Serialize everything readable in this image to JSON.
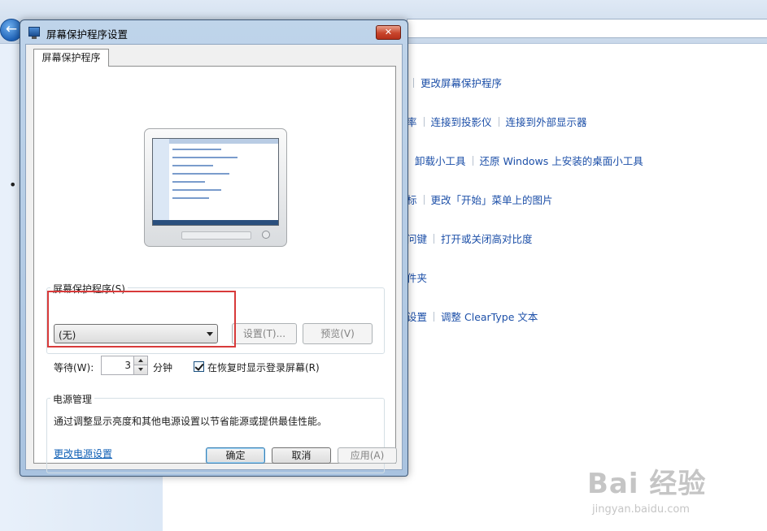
{
  "background": {
    "links": [
      {
        "items": [
          "更改屏幕保护程序"
        ]
      },
      {
        "items": [
          "率",
          "连接到投影仪",
          "连接到外部显示器"
        ]
      },
      {
        "items": [
          "卸载小工具",
          "还原 Windows 上安装的桌面小工具"
        ]
      },
      {
        "items": [
          "标",
          "更改「开始」菜单上的图片"
        ]
      },
      {
        "items": [
          "问键",
          "打开或关闭高对比度"
        ]
      },
      {
        "items": [
          "件夹"
        ]
      },
      {
        "items": [
          "设置",
          "调整 ClearType 文本"
        ]
      }
    ],
    "back_icon": "arrow-left-icon"
  },
  "dialog": {
    "title": "屏幕保护程序设置",
    "close_label": "✕",
    "tab_label": "屏幕保护程序",
    "screensaver": {
      "group_label": "屏幕保护程序(S)",
      "selected": "(无)",
      "settings_button": "设置(T)...",
      "preview_button": "预览(V)"
    },
    "wait": {
      "label": "等待(W):",
      "value": "3",
      "unit": "分钟",
      "checkbox_label": "在恢复时显示登录屏幕(R)",
      "checked": true
    },
    "power": {
      "group_label": "电源管理",
      "description": "通过调整显示亮度和其他电源设置以节省能源或提供最佳性能。",
      "link": "更改电源设置"
    },
    "buttons": {
      "ok": "确定",
      "cancel": "取消",
      "apply": "应用(A)"
    }
  },
  "watermark": {
    "main": "Bai 经验",
    "sub": "jingyan.baidu.com"
  }
}
